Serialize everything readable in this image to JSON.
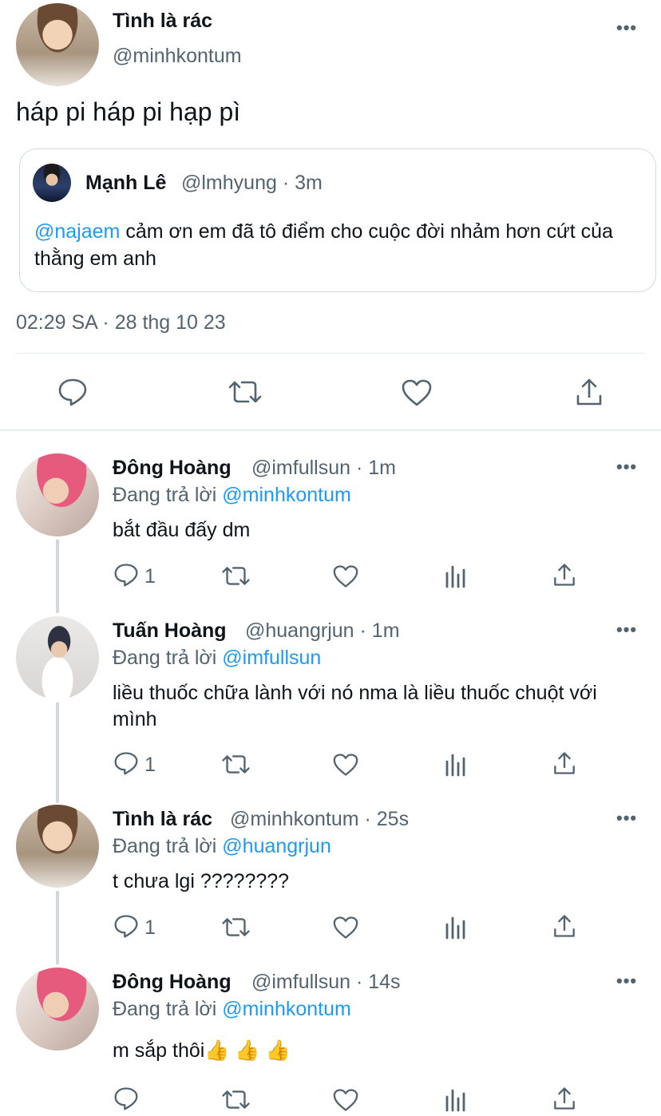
{
  "main_tweet": {
    "author_name": "Tình là rác",
    "author_handle": "@minhkontum",
    "body": "háp pi háp pi hạp pì",
    "more_icon": "more-dots-icon",
    "quoted": {
      "author_name": "Mạnh Lê",
      "author_handle": "@lmhyung",
      "time": "· 3m",
      "mention": "@najaem",
      "text": " cảm ơn em đã tô điểm cho cuộc đời nhảm hơn cứt của thằng em anh"
    },
    "timestamp": "02:29 SA · 28 thg 10 23",
    "actions": [
      "reply-icon",
      "retweet-icon",
      "like-icon",
      "share-icon"
    ]
  },
  "replies": [
    {
      "author_name": "Đông Hoàng",
      "author_meta": "@imfullsun · 1m",
      "replying_prefix": "Đang trả lời ",
      "replying_to": "@minhkontum",
      "text": "bắt đầu đấy dm",
      "reply_count": "1"
    },
    {
      "author_name": "Tuấn Hoàng",
      "author_meta": "@huangrjun · 1m",
      "replying_prefix": "Đang trả lời ",
      "replying_to": "@imfullsun",
      "text": "liều thuốc chữa lành với nó nma là liều thuốc chuột với mình",
      "reply_count": "1"
    },
    {
      "author_name": "Tình là rác",
      "author_meta": "@minhkontum · 25s",
      "replying_prefix": "Đang trả lời ",
      "replying_to": "@huangrjun",
      "text": "t chưa lgi ????????",
      "reply_count": "1"
    },
    {
      "author_name": "Đông Hoàng",
      "author_meta": "@imfullsun · 14s",
      "replying_prefix": "Đang trả lời ",
      "replying_to": "@minhkontum",
      "text": "m sắp thôi",
      "emojis": "👍 👍 👍",
      "reply_count": ""
    }
  ],
  "colors": {
    "link": "#1d9bf0",
    "muted": "#536471",
    "text": "#0f1419",
    "divider": "#e6ecf0"
  }
}
